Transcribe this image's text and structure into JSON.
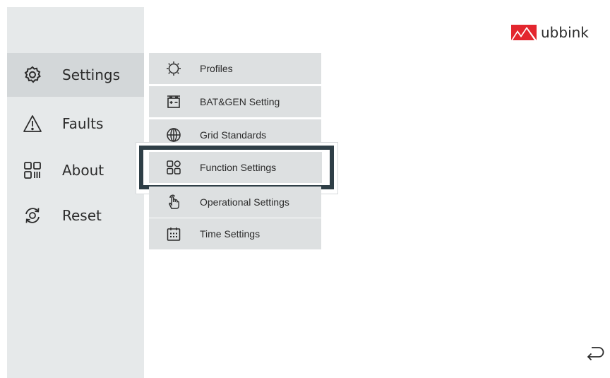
{
  "brand": {
    "name": "ubbink",
    "accent": "#e3262e"
  },
  "sidebar": {
    "items": [
      {
        "label": "Settings",
        "icon": "gear-icon",
        "active": true
      },
      {
        "label": "Faults",
        "icon": "warning-icon",
        "active": false
      },
      {
        "label": "About",
        "icon": "grid-icon",
        "active": false
      },
      {
        "label": "Reset",
        "icon": "reset-icon",
        "active": false
      }
    ]
  },
  "submenu": {
    "items": [
      {
        "label": "Profiles",
        "icon": "profile-sun-icon"
      },
      {
        "label": "BAT&GEN Setting",
        "icon": "battery-icon"
      },
      {
        "label": "Grid Standards",
        "icon": "globe-icon"
      },
      {
        "label": "Function Settings",
        "icon": "function-grid-icon",
        "highlighted": true
      },
      {
        "label": "Operational Settings",
        "icon": "hand-touch-icon"
      },
      {
        "label": "Time Settings",
        "icon": "calendar-icon"
      }
    ]
  },
  "footer": {
    "back_icon": "return-icon"
  }
}
